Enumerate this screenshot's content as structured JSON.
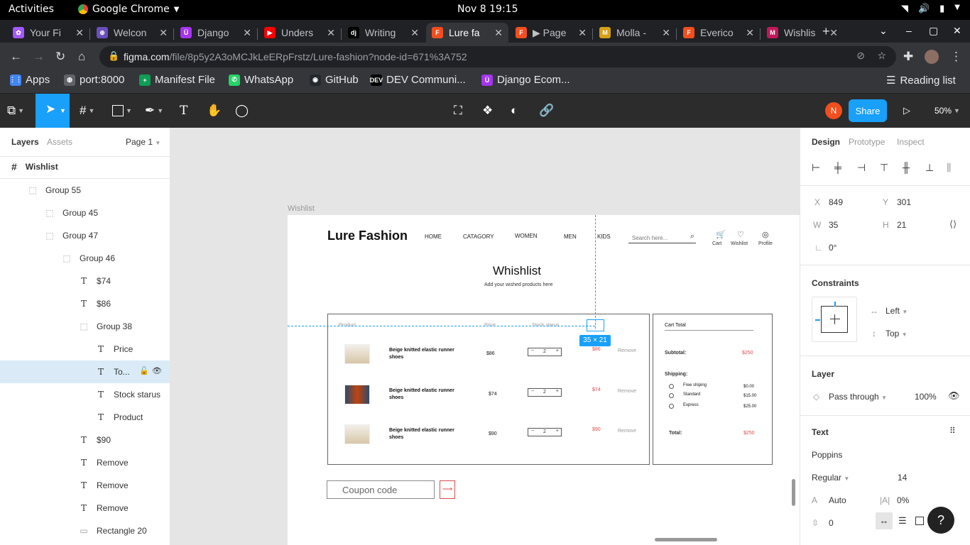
{
  "os": {
    "activities": "Activities",
    "app": "Google Chrome",
    "clock": "Nov 8  19:15"
  },
  "tabs": [
    {
      "title": "Your Fi",
      "color": "#a259ff",
      "glyph": "✿"
    },
    {
      "title": "Welcon",
      "color": "#6b4fbb",
      "glyph": "⊕"
    },
    {
      "title": "Django",
      "color": "#a435f0",
      "glyph": "Ü"
    },
    {
      "title": "Unders",
      "color": "#ff0000",
      "glyph": "▶"
    },
    {
      "title": "Writing",
      "color": "#000000",
      "glyph": "dj"
    },
    {
      "title": "Lure fa",
      "color": "#f24e1e",
      "glyph": "F",
      "active": true
    },
    {
      "title": "▶ Page",
      "color": "#f24e1e",
      "glyph": "F"
    },
    {
      "title": "Molla -",
      "color": "#d4a017",
      "glyph": "M"
    },
    {
      "title": "Everico",
      "color": "#f24e1e",
      "glyph": "F"
    },
    {
      "title": "Wishlis",
      "color": "#c2185b",
      "glyph": "M"
    }
  ],
  "url": {
    "host": "figma.com",
    "path": "/file/8p5y2A3oMCJkLeERpFrstz/Lure-fashion?node-id=671%3A752"
  },
  "bookmarks": [
    {
      "label": "Apps",
      "color": "#4285f4",
      "glyph": "⋮⋮"
    },
    {
      "label": "port:8000",
      "color": "#5f6368",
      "glyph": "◍"
    },
    {
      "label": "Manifest File",
      "color": "#0f9d58",
      "glyph": "+"
    },
    {
      "label": "WhatsApp",
      "color": "#25d366",
      "glyph": "✆"
    },
    {
      "label": "GitHub",
      "color": "#24292e",
      "glyph": "◉"
    },
    {
      "label": "DEV Communi...",
      "color": "#000000",
      "glyph": "DEV"
    },
    {
      "label": "Django Ecom...",
      "color": "#a435f0",
      "glyph": "Ü"
    }
  ],
  "reading_list": "Reading list",
  "figma": {
    "share": "Share",
    "zoom": "50%",
    "avatar": "N"
  },
  "left": {
    "tab_layers": "Layers",
    "tab_assets": "Assets",
    "page": "Page 1",
    "frame": "Wishlist",
    "layers": [
      {
        "label": "Group 55",
        "indent": 0,
        "icon": "group"
      },
      {
        "label": "Group 45",
        "indent": 1,
        "icon": "group"
      },
      {
        "label": "Group 47",
        "indent": 1,
        "icon": "group"
      },
      {
        "label": "Group 46",
        "indent": 2,
        "icon": "group"
      },
      {
        "label": "$74",
        "indent": 3,
        "icon": "text"
      },
      {
        "label": "$86",
        "indent": 3,
        "icon": "text"
      },
      {
        "label": "Group 38",
        "indent": 3,
        "icon": "group"
      },
      {
        "label": "Price",
        "indent": 4,
        "icon": "text"
      },
      {
        "label": "To...",
        "indent": 4,
        "icon": "text",
        "selected": true
      },
      {
        "label": "Stock starus",
        "indent": 4,
        "icon": "text"
      },
      {
        "label": "Product",
        "indent": 4,
        "icon": "text"
      },
      {
        "label": "$90",
        "indent": 3,
        "icon": "text"
      },
      {
        "label": "Remove",
        "indent": 3,
        "icon": "text"
      },
      {
        "label": "Remove",
        "indent": 3,
        "icon": "text"
      },
      {
        "label": "Remove",
        "indent": 3,
        "icon": "text"
      },
      {
        "label": "Rectangle 20",
        "indent": 3,
        "icon": "rect"
      }
    ]
  },
  "canvas": {
    "frame_label": "Wishlist",
    "size_badge": "35 × 21"
  },
  "design": {
    "brand": "Lure Fashion",
    "nav": [
      "HOME",
      "CATAGORY",
      "WOMEN",
      "MEN",
      "KIDS"
    ],
    "search_placeholder": "Search here...",
    "icons": [
      "Cart",
      "Wishlist",
      "Profile"
    ],
    "title": "Whishlist",
    "subtitle": "Add your wished products here",
    "headers": {
      "product": "Product",
      "price": "Price",
      "stock": "Stock starus"
    },
    "rows": [
      {
        "name": "Beige knitted elastic runner shoes",
        "price": "$86",
        "qty": "2",
        "total": "$86",
        "remove": "Remove"
      },
      {
        "name": "Beige knitted elastic runner shoes",
        "price": "$74",
        "qty": "2",
        "total": "$74",
        "remove": "Remove"
      },
      {
        "name": "Beige knitted elastic runner shoes",
        "price": "$90",
        "qty": "2",
        "total": "$90",
        "remove": "Remove"
      }
    ],
    "cart": {
      "title": "Cart Total",
      "subtotal_label": "Subtotal:",
      "subtotal": "$250",
      "shipping_label": "Shipping:",
      "options": [
        {
          "label": "Free shiping",
          "price": "$0.00"
        },
        {
          "label": "Standard",
          "price": "$15.00"
        },
        {
          "label": "Express",
          "price": "$25.00"
        }
      ],
      "total_label": "Total:",
      "total": "$250"
    },
    "coupon": "Coupon code"
  },
  "right": {
    "tabs": [
      "Design",
      "Prototype",
      "Inspect"
    ],
    "x": "849",
    "y": "301",
    "w": "35",
    "h": "21",
    "rotation": "0°",
    "constraints": "Constraints",
    "c_h": "Left",
    "c_v": "Top",
    "layer": "Layer",
    "blend": "Pass through",
    "opacity": "100%",
    "text": "Text",
    "font": "Poppins",
    "weight": "Regular",
    "size": "14",
    "line_height": "Auto",
    "letter_spacing": "0%",
    "para": "0"
  },
  "colors": {
    "figma_blue": "#18a0fb",
    "accent_red": "#e04b4b"
  }
}
